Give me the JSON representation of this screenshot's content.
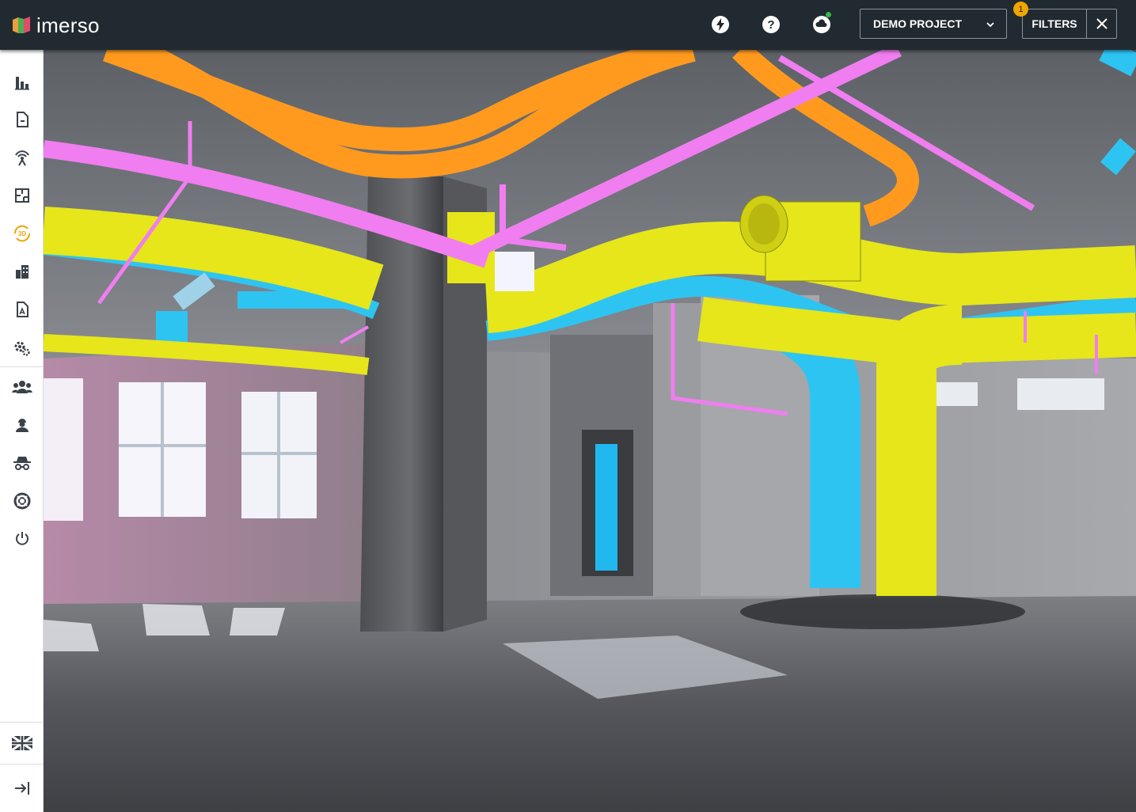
{
  "app": {
    "logo_text": "imerso"
  },
  "header": {
    "project_select": {
      "value": "DEMO PROJECT"
    },
    "filters": {
      "label": "FILTERS",
      "badge_count": "1"
    },
    "icons": [
      "lightning-icon",
      "help-icon",
      "cloud-sync-icon"
    ]
  },
  "sidebar": {
    "items": [
      {
        "icon": "bar-chart-icon"
      },
      {
        "icon": "document-icon"
      },
      {
        "icon": "scanner-icon"
      },
      {
        "icon": "floorplan-icon"
      },
      {
        "icon": "3d-view-icon",
        "active": true
      },
      {
        "icon": "building-icon"
      },
      {
        "icon": "drawing-icon"
      },
      {
        "icon": "settings-icon"
      },
      {
        "icon": "users-icon"
      },
      {
        "icon": "worker-icon"
      },
      {
        "icon": "incognito-icon"
      },
      {
        "icon": "support-icon"
      },
      {
        "icon": "power-icon"
      }
    ],
    "bottom": [
      {
        "icon": "uk-flag-icon"
      },
      {
        "icon": "collapse-sidebar-icon"
      }
    ]
  },
  "colors": {
    "topbar": "#222a31",
    "accent": "#f0a500",
    "pipe_orange": "#ff9a1f",
    "pipe_magenta": "#f07ef0",
    "pipe_yellow": "#e6e61a",
    "pipe_blue": "#2ec4f2"
  }
}
